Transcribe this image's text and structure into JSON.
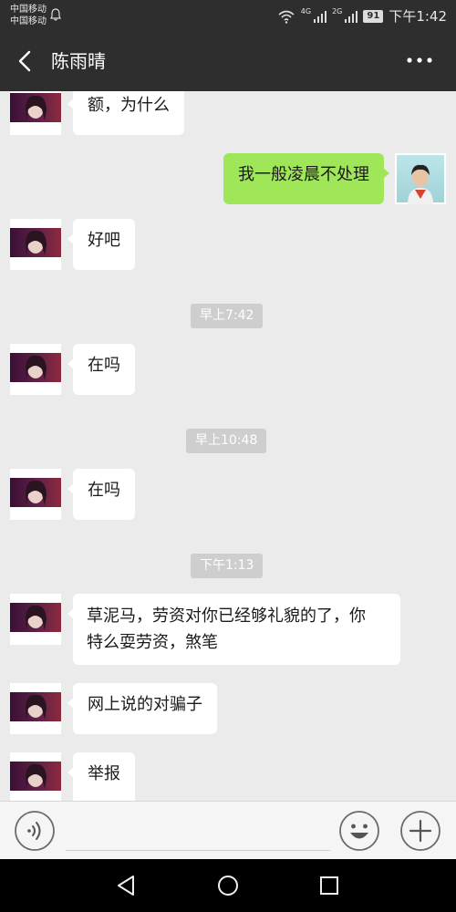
{
  "status_bar": {
    "carrier_1": "中国移动",
    "carrier_2": "中国移动",
    "network_1": "4G",
    "network_2": "2G",
    "battery": "91",
    "time": "下午1:42"
  },
  "header": {
    "title": "陈雨晴"
  },
  "messages": [
    {
      "side": "left",
      "text": "额，为什么"
    },
    {
      "side": "right",
      "text": "我一般凌晨不处理"
    },
    {
      "side": "left",
      "text": "好吧"
    },
    {
      "type": "time",
      "text": "早上7:42"
    },
    {
      "side": "left",
      "text": "在吗"
    },
    {
      "type": "time",
      "text": "早上10:48"
    },
    {
      "side": "left",
      "text": "在吗"
    },
    {
      "type": "time",
      "text": "下午1:13"
    },
    {
      "side": "left",
      "line1": "草泥马，劳资对你已经够礼貌的了，你",
      "line2": "特么耍劳资，煞笔"
    },
    {
      "side": "left",
      "text": "网上说的对骗子"
    },
    {
      "side": "left",
      "text": "举报"
    }
  ],
  "input_bar": {
    "voice_icon": "voice-icon",
    "emoji_icon": "emoji-icon",
    "plus_icon": "plus-icon"
  },
  "colors": {
    "header_bg": "#2e2e2e",
    "chat_bg": "#ebebeb",
    "self_bubble": "#9fe658",
    "other_bubble": "#ffffff"
  }
}
